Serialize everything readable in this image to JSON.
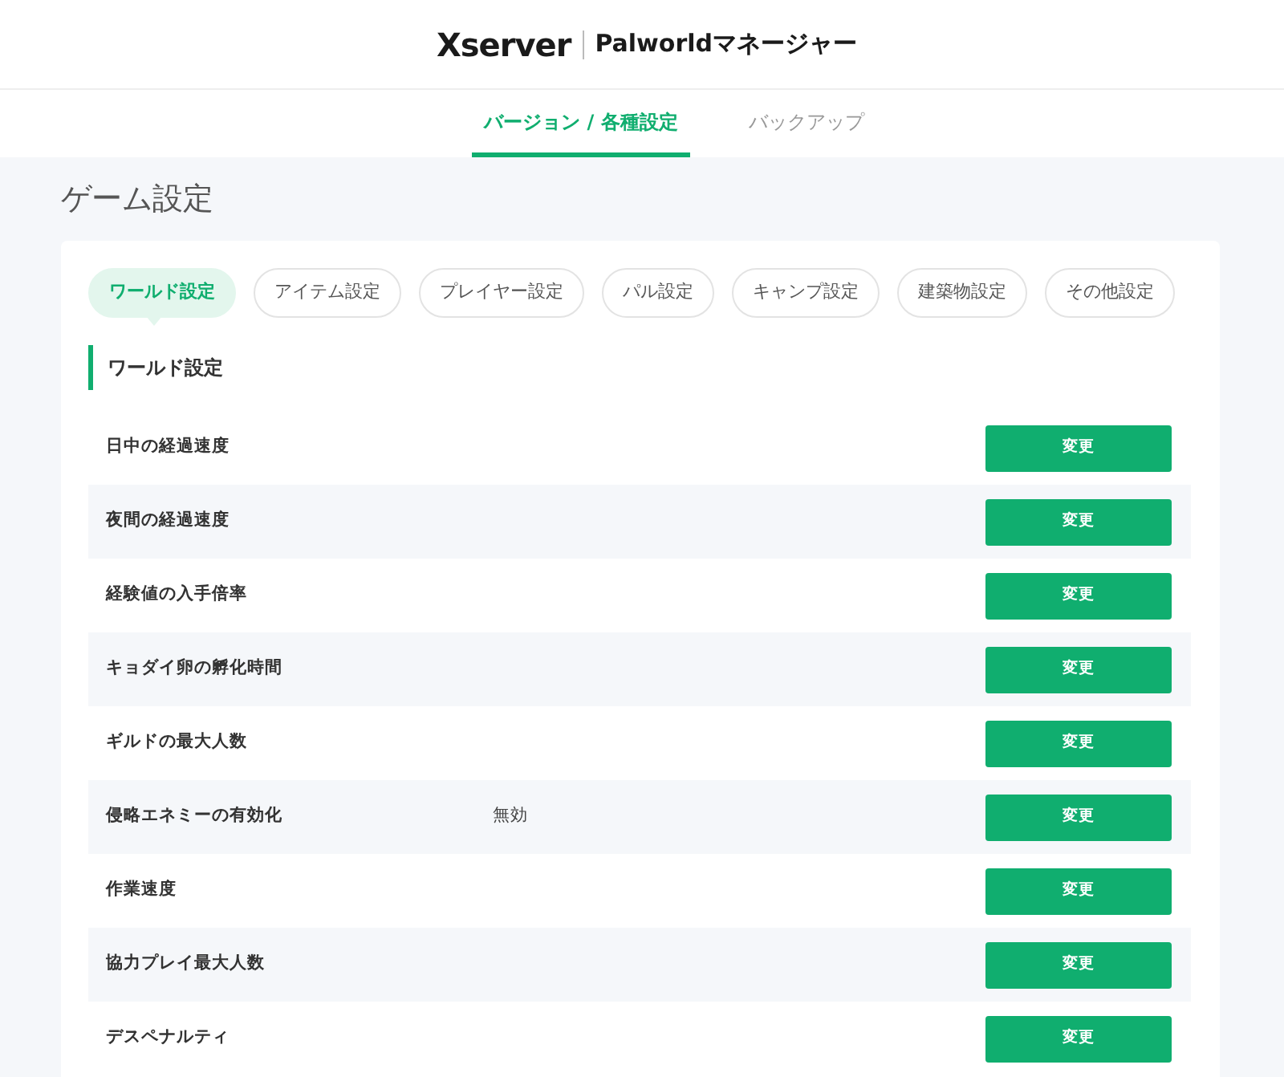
{
  "header": {
    "brand": "Xserver",
    "product": "Palworldマネージャー"
  },
  "nav_tabs": [
    {
      "label": "バージョン / 各種設定",
      "selected": true
    },
    {
      "label": "バックアップ",
      "selected": false
    }
  ],
  "page_title": "ゲーム設定",
  "category_tabs": [
    {
      "label": "ワールド設定",
      "selected": true
    },
    {
      "label": "アイテム設定",
      "selected": false
    },
    {
      "label": "プレイヤー設定",
      "selected": false
    },
    {
      "label": "パル設定",
      "selected": false
    },
    {
      "label": "キャンプ設定",
      "selected": false
    },
    {
      "label": "建築物設定",
      "selected": false
    },
    {
      "label": "その他設定",
      "selected": false
    }
  ],
  "section_title": "ワールド設定",
  "settings": [
    {
      "label": "日中の経過速度",
      "button": "変更"
    },
    {
      "label": "夜間の経過速度",
      "button": "変更"
    },
    {
      "label": "経験値の入手倍率",
      "button": "変更"
    },
    {
      "label": "キョダイ卵の孵化時間",
      "button": "変更"
    },
    {
      "label": "ギルドの最大人数",
      "button": "変更"
    },
    {
      "label": "侵略エネミーの有効化",
      "value": "無効",
      "button": "変更"
    },
    {
      "label": "作業速度",
      "button": "変更"
    },
    {
      "label": "協力プレイ最大人数",
      "button": "変更"
    },
    {
      "label": "デスペナルティ",
      "button": "変更"
    }
  ]
}
